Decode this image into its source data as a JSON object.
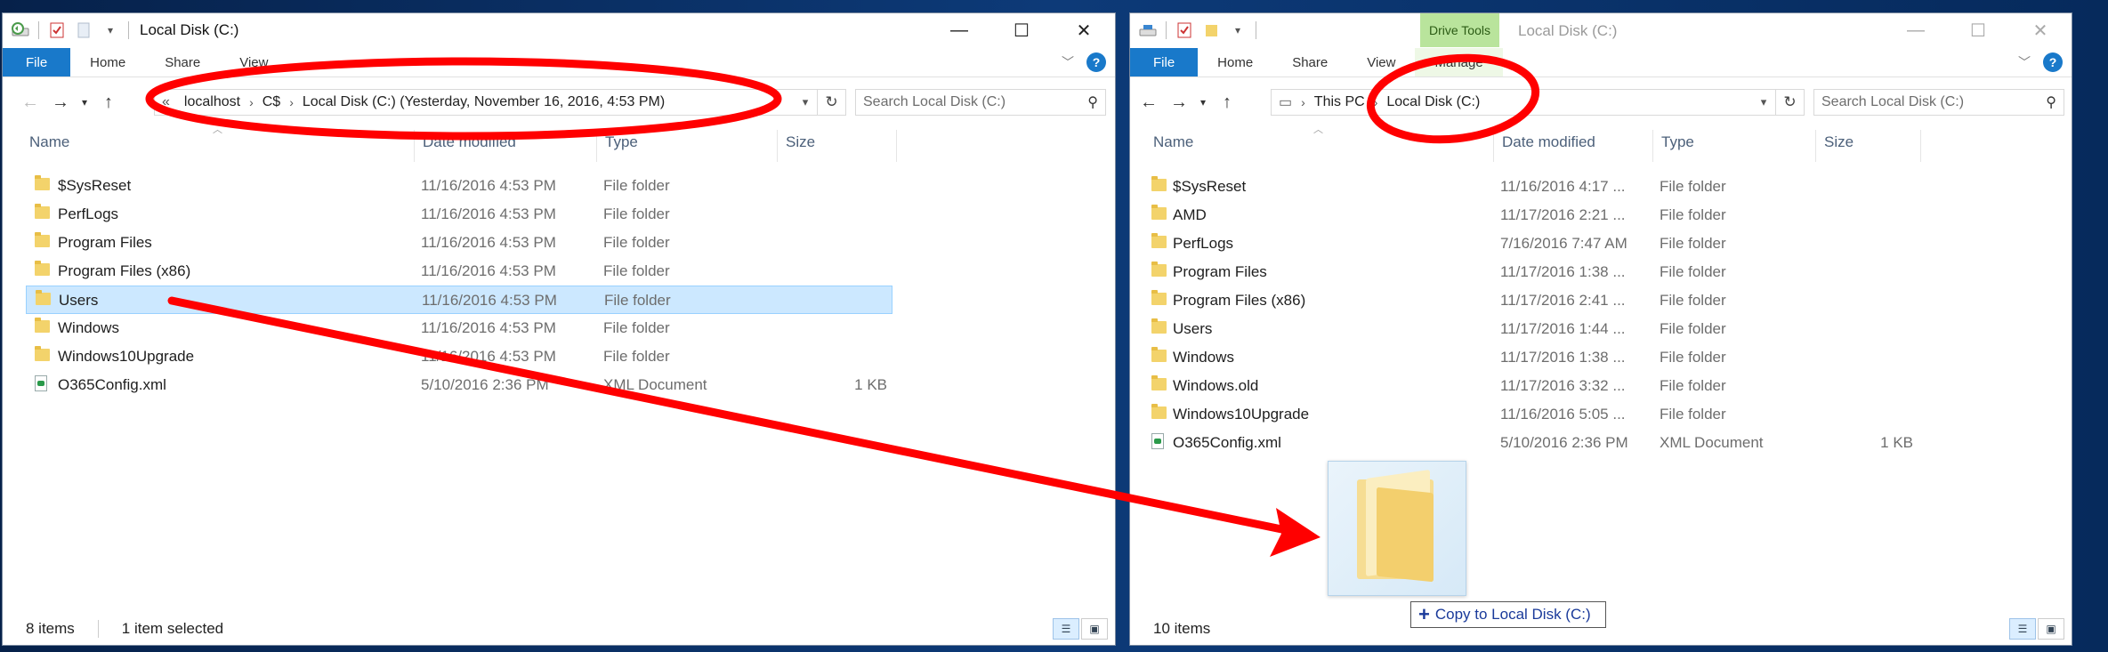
{
  "left_window": {
    "title": "Local Disk (C:)",
    "ribbon_tabs": [
      "File",
      "Home",
      "Share",
      "View"
    ],
    "address": {
      "overflow": "«",
      "segments": [
        "localhost",
        "C$",
        "Local Disk (C:) (Yesterday, November 16, 2016, 4:53 PM)"
      ]
    },
    "search_placeholder": "Search Local Disk (C:)",
    "columns": {
      "name": "Name",
      "date": "Date modified",
      "type": "Type",
      "size": "Size"
    },
    "files": [
      {
        "icon": "folder-icon",
        "name": "$SysReset",
        "date": "11/16/2016 4:53 PM",
        "type": "File folder",
        "size": ""
      },
      {
        "icon": "folder-icon",
        "name": "PerfLogs",
        "date": "11/16/2016 4:53 PM",
        "type": "File folder",
        "size": ""
      },
      {
        "icon": "folder-icon",
        "name": "Program Files",
        "date": "11/16/2016 4:53 PM",
        "type": "File folder",
        "size": ""
      },
      {
        "icon": "folder-icon",
        "name": "Program Files (x86)",
        "date": "11/16/2016 4:53 PM",
        "type": "File folder",
        "size": ""
      },
      {
        "icon": "folder-icon",
        "name": "Users",
        "date": "11/16/2016 4:53 PM",
        "type": "File folder",
        "size": "",
        "selected": true
      },
      {
        "icon": "folder-icon",
        "name": "Windows",
        "date": "11/16/2016 4:53 PM",
        "type": "File folder",
        "size": ""
      },
      {
        "icon": "folder-icon",
        "name": "Windows10Upgrade",
        "date": "11/16/2016 4:53 PM",
        "type": "File folder",
        "size": ""
      },
      {
        "icon": "xml-file-icon",
        "name": "O365Config.xml",
        "date": "5/10/2016 2:36 PM",
        "type": "XML Document",
        "size": "1 KB"
      }
    ],
    "status_count": "8 items",
    "status_selected": "1 item selected"
  },
  "right_window": {
    "title": "Local Disk (C:)",
    "contextual_tab": "Drive Tools",
    "ribbon_tabs": [
      "File",
      "Home",
      "Share",
      "View",
      "Manage"
    ],
    "address": {
      "segments": [
        "This PC",
        "Local Disk (C:)"
      ]
    },
    "search_placeholder": "Search Local Disk (C:)",
    "columns": {
      "name": "Name",
      "date": "Date modified",
      "type": "Type",
      "size": "Size"
    },
    "files": [
      {
        "icon": "folder-icon",
        "name": "$SysReset",
        "date": "11/16/2016 4:17 ...",
        "type": "File folder",
        "size": ""
      },
      {
        "icon": "folder-icon",
        "name": "AMD",
        "date": "11/17/2016 2:21 ...",
        "type": "File folder",
        "size": ""
      },
      {
        "icon": "folder-icon",
        "name": "PerfLogs",
        "date": "7/16/2016 7:47 AM",
        "type": "File folder",
        "size": ""
      },
      {
        "icon": "folder-icon",
        "name": "Program Files",
        "date": "11/17/2016 1:38 ...",
        "type": "File folder",
        "size": ""
      },
      {
        "icon": "folder-icon",
        "name": "Program Files (x86)",
        "date": "11/17/2016 2:41 ...",
        "type": "File folder",
        "size": ""
      },
      {
        "icon": "folder-icon",
        "name": "Users",
        "date": "11/17/2016 1:44 ...",
        "type": "File folder",
        "size": ""
      },
      {
        "icon": "folder-icon",
        "name": "Windows",
        "date": "11/17/2016 1:38 ...",
        "type": "File folder",
        "size": ""
      },
      {
        "icon": "folder-icon",
        "name": "Windows.old",
        "date": "11/17/2016 3:32 ...",
        "type": "File folder",
        "size": ""
      },
      {
        "icon": "folder-icon",
        "name": "Windows10Upgrade",
        "date": "11/16/2016 5:05 ...",
        "type": "File folder",
        "size": ""
      },
      {
        "icon": "xml-file-icon",
        "name": "O365Config.xml",
        "date": "5/10/2016 2:36 PM",
        "type": "XML Document",
        "size": "1 KB"
      }
    ],
    "status_count": "10 items"
  },
  "drag_tooltip": {
    "plus": "+",
    "text": "Copy to Local Disk (C:)"
  },
  "annotation": {
    "color": "#ff0000",
    "marks": [
      "ellipse-around-left-address",
      "ellipse-around-right-address",
      "arrow-from-users-to-right-window"
    ]
  },
  "colors": {
    "accent": "#1979ca",
    "selection": "#cce8ff",
    "drive_tools_tab": "#b9e49c",
    "folder": "#f3d36b"
  }
}
